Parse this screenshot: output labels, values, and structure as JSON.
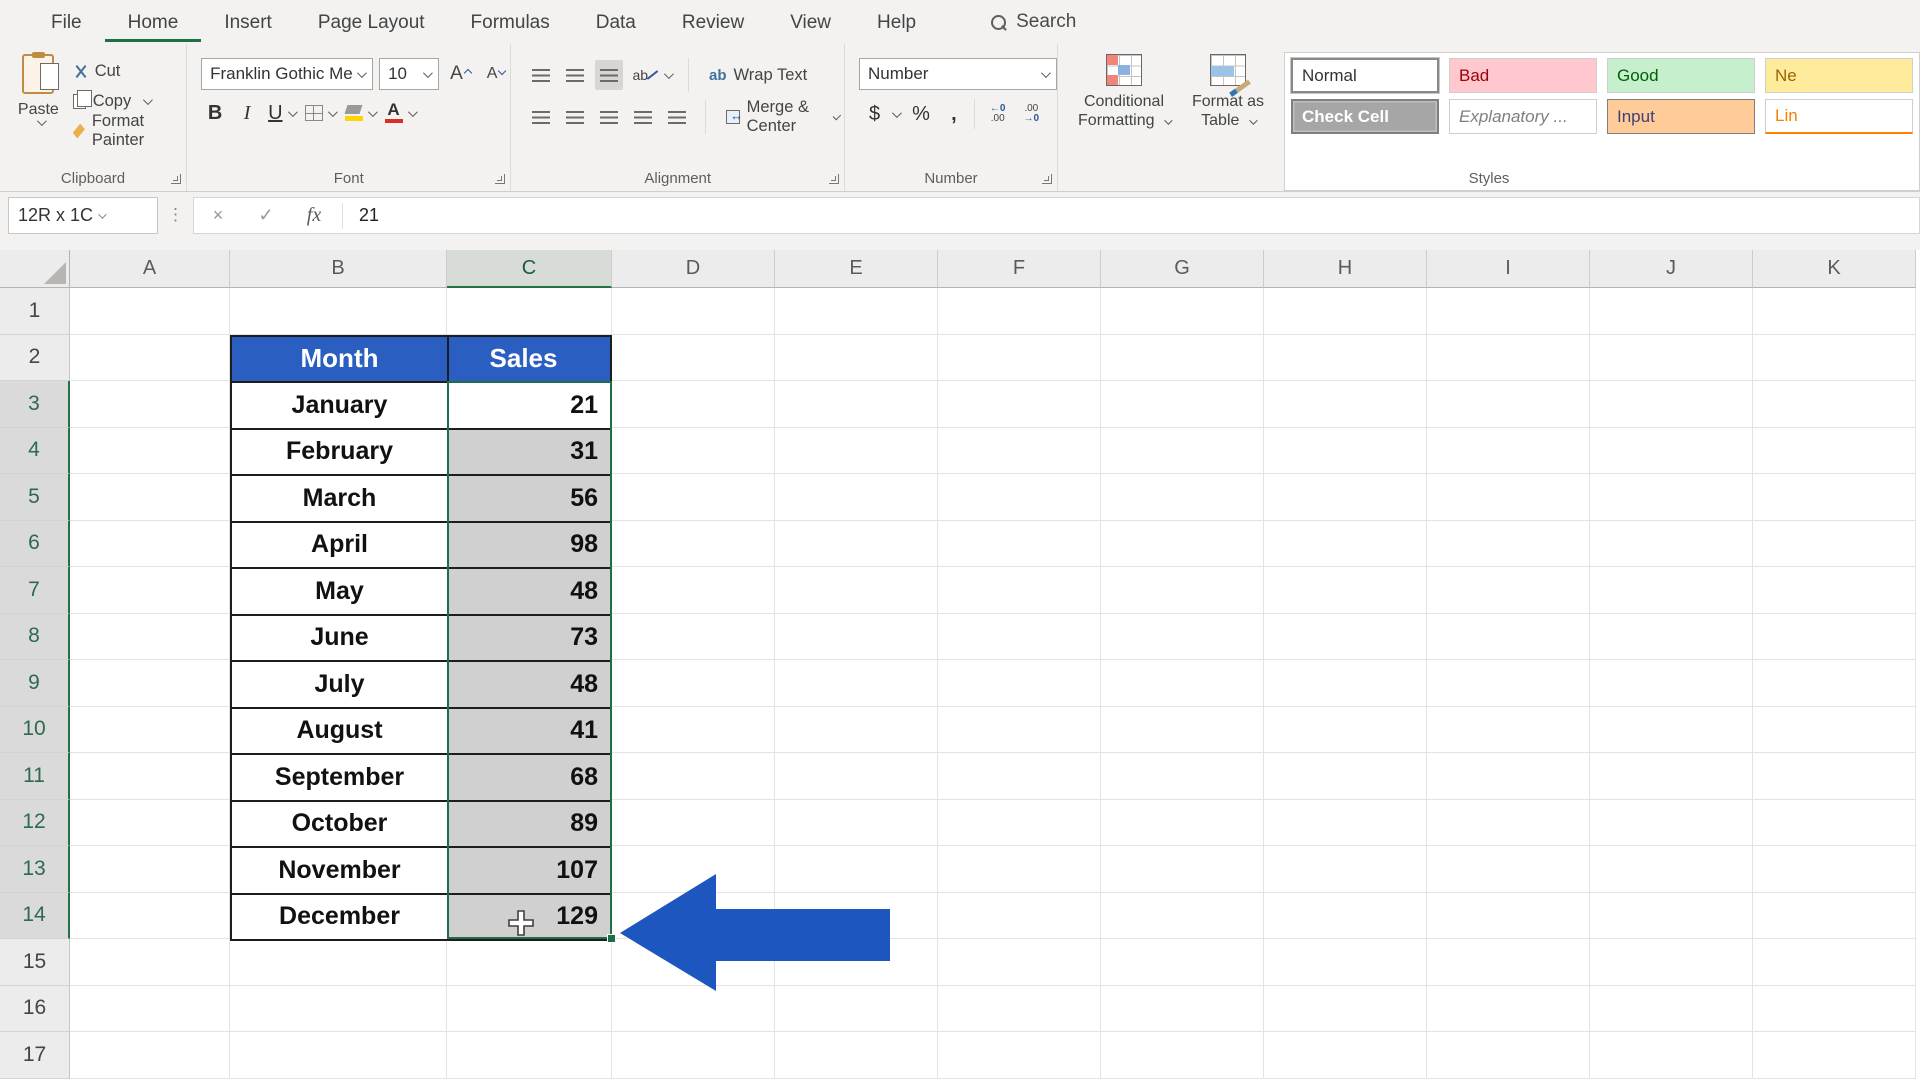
{
  "menu": {
    "tabs": [
      {
        "label": "File"
      },
      {
        "label": "Home",
        "active": true
      },
      {
        "label": "Insert"
      },
      {
        "label": "Page Layout"
      },
      {
        "label": "Formulas"
      },
      {
        "label": "Data"
      },
      {
        "label": "Review"
      },
      {
        "label": "View"
      },
      {
        "label": "Help"
      }
    ],
    "search": {
      "label": "Search"
    }
  },
  "ribbon": {
    "clipboard": {
      "label": "Clipboard",
      "paste_label": "Paste",
      "cut_label": "Cut",
      "copy_label": "Copy",
      "format_painter_label": "Format Painter"
    },
    "font": {
      "label": "Font",
      "font_name": "Franklin Gothic Me",
      "font_size": "10",
      "bold": "B",
      "italic": "I",
      "underline": "U",
      "font_color_letter": "A"
    },
    "alignment": {
      "label": "Alignment",
      "wrap_text_label": "Wrap Text",
      "merge_center_label": "Merge & Center",
      "orient_glyph": "ab",
      "wrap_glyph": "ab"
    },
    "number": {
      "label": "Number",
      "format_value": "Number",
      "currency": "$",
      "percent": "%",
      "comma": ",",
      "inc_decimal": "←0\n.00",
      "dec_decimal": ".00\n→0"
    },
    "styles": {
      "label": "Styles",
      "conditional_line1": "Conditional",
      "conditional_line2": "Formatting",
      "format_table_line1": "Format as",
      "format_table_line2": "Table",
      "gallery": [
        {
          "label": "Normal",
          "style": "normal",
          "selected": true
        },
        {
          "label": "Bad",
          "style": "bad"
        },
        {
          "label": "Good",
          "style": "good"
        },
        {
          "label": "Ne",
          "style": "neutral"
        },
        {
          "label": "Check Cell",
          "style": "check"
        },
        {
          "label": "Explanatory ...",
          "style": "expl"
        },
        {
          "label": "Input",
          "style": "input"
        },
        {
          "label": "Lin",
          "style": "linked"
        }
      ]
    }
  },
  "formula_bar": {
    "name_box": "12R x 1C",
    "cancel_glyph": "×",
    "enter_glyph": "✓",
    "fx_label": "fx",
    "value": "21"
  },
  "sheet": {
    "columns": [
      "A",
      "B",
      "C",
      "D",
      "E",
      "F",
      "G",
      "H",
      "I",
      "J",
      "K"
    ],
    "selected_column": "C",
    "row_labels": [
      "1",
      "2",
      "3",
      "4",
      "5",
      "6",
      "7",
      "8",
      "9",
      "10",
      "11",
      "12",
      "13",
      "14",
      "15",
      "16",
      "17"
    ],
    "selected_rows_start": 3,
    "selected_rows_end": 14,
    "table": {
      "headers": [
        "Month",
        "Sales"
      ],
      "rows": [
        [
          "January",
          "21"
        ],
        [
          "February",
          "31"
        ],
        [
          "March",
          "56"
        ],
        [
          "April",
          "98"
        ],
        [
          "May",
          "48"
        ],
        [
          "June",
          "73"
        ],
        [
          "July",
          "48"
        ],
        [
          "August",
          "41"
        ],
        [
          "September",
          "68"
        ],
        [
          "October",
          "89"
        ],
        [
          "November",
          "107"
        ],
        [
          "December",
          "129"
        ]
      ]
    }
  },
  "colors": {
    "excel_green": "#217346",
    "table_header_blue": "#2a5fc1",
    "arrow_blue": "#1e56c0",
    "selection_fill": "#d0d0d0",
    "bad_bg": "#ffc7ce",
    "bad_text": "#9c0006",
    "good_bg": "#c6efce",
    "good_text": "#006100",
    "neutral_bg": "#ffeb9c",
    "neutral_text": "#9c6500",
    "input_bg": "#ffcc99",
    "input_text": "#3f3f76",
    "check_cell_bg": "#a6a6a6",
    "linked_cell_text": "#fa7d00"
  }
}
